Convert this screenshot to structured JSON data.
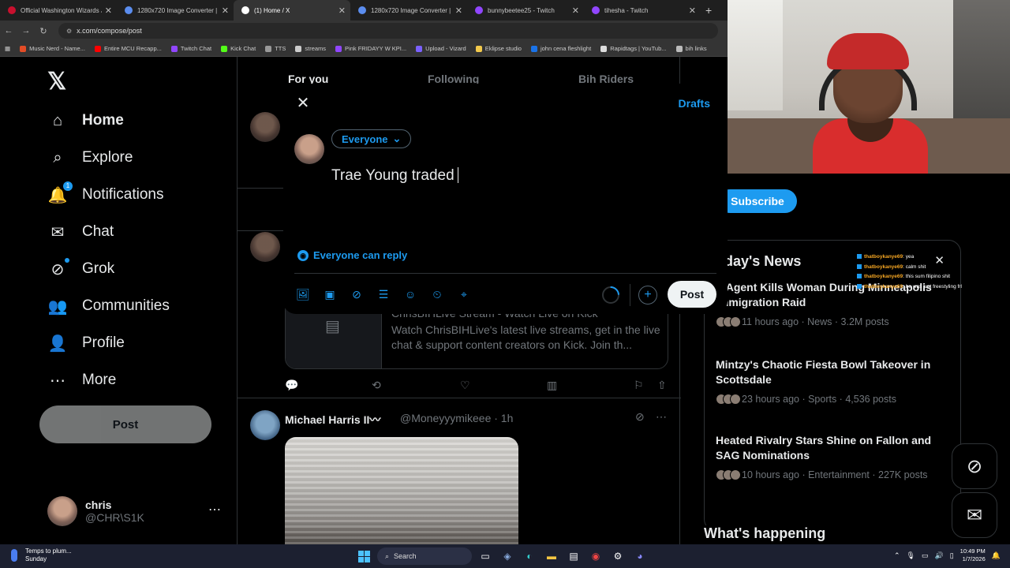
{
  "browser": {
    "tabs": [
      {
        "title": "Official Washington Wizards Je",
        "color": "#c8102e",
        "active": false
      },
      {
        "title": "1280x720 Image Converter | Fr",
        "color": "#5b8def",
        "active": false
      },
      {
        "title": "(1) Home / X",
        "color": "#ffffff",
        "active": true
      },
      {
        "title": "1280x720 Image Converter | Fr",
        "color": "#5b8def",
        "active": false
      },
      {
        "title": "bunnybeetee25 - Twitch",
        "color": "#9146ff",
        "active": false
      },
      {
        "title": "tihesha - Twitch",
        "color": "#9146ff",
        "active": false
      }
    ],
    "url": "x.com/compose/post",
    "bookmarks": [
      {
        "label": "Music Nerd - Name...",
        "color": "#e34c26"
      },
      {
        "label": "Entire MCU Recapp...",
        "color": "#ff0000"
      },
      {
        "label": "Twitch Chat",
        "color": "#9146ff"
      },
      {
        "label": "Kick Chat",
        "color": "#53fc18"
      },
      {
        "label": "TTS",
        "color": "#999999"
      },
      {
        "label": "streams",
        "color": "#cccccc"
      },
      {
        "label": "Pink FRIDAYY W KPI...",
        "color": "#9146ff"
      },
      {
        "label": "Upload - Vizard",
        "color": "#7b61ff"
      },
      {
        "label": "Eklipse studio",
        "color": "#f2c94c"
      },
      {
        "label": "john cena fleshlight",
        "color": "#1a73e8"
      },
      {
        "label": "Rapidtags | YouTub...",
        "color": "#dddddd"
      },
      {
        "label": "bih links",
        "color": "#bbbbbb"
      }
    ]
  },
  "nav": {
    "items": [
      {
        "label": "Home",
        "icon": "home-icon",
        "glyph": "⌂"
      },
      {
        "label": "Explore",
        "icon": "search-icon",
        "glyph": "⌕"
      },
      {
        "label": "Notifications",
        "icon": "bell-icon",
        "glyph": "🔔",
        "badge": "1"
      },
      {
        "label": "Chat",
        "icon": "mail-icon",
        "glyph": "✉"
      },
      {
        "label": "Grok",
        "icon": "grok-icon",
        "glyph": "⊘"
      },
      {
        "label": "Communities",
        "icon": "people-icon",
        "glyph": "👥"
      },
      {
        "label": "Profile",
        "icon": "person-icon",
        "glyph": "👤"
      },
      {
        "label": "More",
        "icon": "more-circle-icon",
        "glyph": "⋯"
      }
    ],
    "post_label": "Post",
    "account": {
      "name": "chris",
      "handle": "@CHR\\S1K"
    }
  },
  "timeline": {
    "tabs": [
      "For you",
      "Following",
      "Bih Riders"
    ],
    "card": {
      "title": "ChrisBIHLive Stream - Watch Live on Kick",
      "description": "Watch ChrisBIHLive's latest live streams, get in the live chat & support content creators on Kick. Join th..."
    },
    "post": {
      "name": "Michael Harris II〰",
      "handle": "@Moneyyymikeee · 1h"
    }
  },
  "compose": {
    "drafts_label": "Drafts",
    "audience": "Everyone",
    "text": "Trae Young traded",
    "reply_setting": "Everyone can reply",
    "post_label": "Post",
    "char_progress": 0.12,
    "tools": [
      "image-icon",
      "gif-icon",
      "grok-icon",
      "poll-icon",
      "emoji-icon",
      "schedule-icon",
      "location-icon"
    ]
  },
  "right": {
    "subscribe_label": "Subscribe",
    "news_title": "oday's News",
    "news": [
      {
        "title": "E Agent Kills Woman During Minneapolis Immigration Raid",
        "meta": "11 hours ago · News · 3.2M posts"
      },
      {
        "title": "Mintzy's Chaotic Fiesta Bowl Takeover in Scottsdale",
        "meta": "23 hours ago · Sports · 4,536 posts"
      },
      {
        "title": "Heated Rivalry Stars Shine on Fallon and SAG Nominations",
        "meta": "10 hours ago · Entertainment · 227K posts"
      }
    ],
    "whats_happening": "What's happening"
  },
  "chat_overlay": [
    {
      "user": "thatboykanye69",
      "msg": ": yea"
    },
    {
      "user": "thatboykanye69",
      "msg": ": calm shit"
    },
    {
      "user": "thatboykanye69",
      "msg": ": this sum filipino shit"
    },
    {
      "user": "thatboykanye69",
      "msg": ": he was just freestyling frl"
    }
  ],
  "taskbar": {
    "weather_line1": "Temps to plum...",
    "weather_line2": "Sunday",
    "search_label": "Search",
    "time": "10:49 PM",
    "date": "1/7/2026"
  }
}
